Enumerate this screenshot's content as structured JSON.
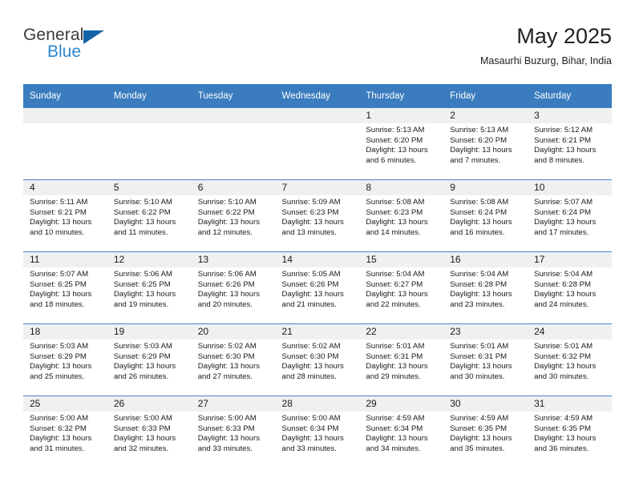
{
  "brand": {
    "name_top": "General",
    "name_bottom": "Blue",
    "triangle_color": "#1463a8",
    "blue_color": "#2a87d0"
  },
  "header": {
    "title": "May 2025",
    "subtitle": "Masaurhi Buzurg, Bihar, India"
  },
  "theme": {
    "header_bg": "#3a7cbe",
    "row_divider": "#4a86c0",
    "numband_bg": "#f0f0f0",
    "cell_bg": "#ffffff"
  },
  "weekday_headers": [
    "Sunday",
    "Monday",
    "Tuesday",
    "Wednesday",
    "Thursday",
    "Friday",
    "Saturday"
  ],
  "weeks": [
    [
      {
        "day": "",
        "sunrise": "",
        "sunset": "",
        "daylight": ""
      },
      {
        "day": "",
        "sunrise": "",
        "sunset": "",
        "daylight": ""
      },
      {
        "day": "",
        "sunrise": "",
        "sunset": "",
        "daylight": ""
      },
      {
        "day": "",
        "sunrise": "",
        "sunset": "",
        "daylight": ""
      },
      {
        "day": "1",
        "sunrise": "Sunrise: 5:13 AM",
        "sunset": "Sunset: 6:20 PM",
        "daylight": "Daylight: 13 hours and 6 minutes."
      },
      {
        "day": "2",
        "sunrise": "Sunrise: 5:13 AM",
        "sunset": "Sunset: 6:20 PM",
        "daylight": "Daylight: 13 hours and 7 minutes."
      },
      {
        "day": "3",
        "sunrise": "Sunrise: 5:12 AM",
        "sunset": "Sunset: 6:21 PM",
        "daylight": "Daylight: 13 hours and 8 minutes."
      }
    ],
    [
      {
        "day": "4",
        "sunrise": "Sunrise: 5:11 AM",
        "sunset": "Sunset: 6:21 PM",
        "daylight": "Daylight: 13 hours and 10 minutes."
      },
      {
        "day": "5",
        "sunrise": "Sunrise: 5:10 AM",
        "sunset": "Sunset: 6:22 PM",
        "daylight": "Daylight: 13 hours and 11 minutes."
      },
      {
        "day": "6",
        "sunrise": "Sunrise: 5:10 AM",
        "sunset": "Sunset: 6:22 PM",
        "daylight": "Daylight: 13 hours and 12 minutes."
      },
      {
        "day": "7",
        "sunrise": "Sunrise: 5:09 AM",
        "sunset": "Sunset: 6:23 PM",
        "daylight": "Daylight: 13 hours and 13 minutes."
      },
      {
        "day": "8",
        "sunrise": "Sunrise: 5:08 AM",
        "sunset": "Sunset: 6:23 PM",
        "daylight": "Daylight: 13 hours and 14 minutes."
      },
      {
        "day": "9",
        "sunrise": "Sunrise: 5:08 AM",
        "sunset": "Sunset: 6:24 PM",
        "daylight": "Daylight: 13 hours and 16 minutes."
      },
      {
        "day": "10",
        "sunrise": "Sunrise: 5:07 AM",
        "sunset": "Sunset: 6:24 PM",
        "daylight": "Daylight: 13 hours and 17 minutes."
      }
    ],
    [
      {
        "day": "11",
        "sunrise": "Sunrise: 5:07 AM",
        "sunset": "Sunset: 6:25 PM",
        "daylight": "Daylight: 13 hours and 18 minutes."
      },
      {
        "day": "12",
        "sunrise": "Sunrise: 5:06 AM",
        "sunset": "Sunset: 6:25 PM",
        "daylight": "Daylight: 13 hours and 19 minutes."
      },
      {
        "day": "13",
        "sunrise": "Sunrise: 5:06 AM",
        "sunset": "Sunset: 6:26 PM",
        "daylight": "Daylight: 13 hours and 20 minutes."
      },
      {
        "day": "14",
        "sunrise": "Sunrise: 5:05 AM",
        "sunset": "Sunset: 6:26 PM",
        "daylight": "Daylight: 13 hours and 21 minutes."
      },
      {
        "day": "15",
        "sunrise": "Sunrise: 5:04 AM",
        "sunset": "Sunset: 6:27 PM",
        "daylight": "Daylight: 13 hours and 22 minutes."
      },
      {
        "day": "16",
        "sunrise": "Sunrise: 5:04 AM",
        "sunset": "Sunset: 6:28 PM",
        "daylight": "Daylight: 13 hours and 23 minutes."
      },
      {
        "day": "17",
        "sunrise": "Sunrise: 5:04 AM",
        "sunset": "Sunset: 6:28 PM",
        "daylight": "Daylight: 13 hours and 24 minutes."
      }
    ],
    [
      {
        "day": "18",
        "sunrise": "Sunrise: 5:03 AM",
        "sunset": "Sunset: 6:29 PM",
        "daylight": "Daylight: 13 hours and 25 minutes."
      },
      {
        "day": "19",
        "sunrise": "Sunrise: 5:03 AM",
        "sunset": "Sunset: 6:29 PM",
        "daylight": "Daylight: 13 hours and 26 minutes."
      },
      {
        "day": "20",
        "sunrise": "Sunrise: 5:02 AM",
        "sunset": "Sunset: 6:30 PM",
        "daylight": "Daylight: 13 hours and 27 minutes."
      },
      {
        "day": "21",
        "sunrise": "Sunrise: 5:02 AM",
        "sunset": "Sunset: 6:30 PM",
        "daylight": "Daylight: 13 hours and 28 minutes."
      },
      {
        "day": "22",
        "sunrise": "Sunrise: 5:01 AM",
        "sunset": "Sunset: 6:31 PM",
        "daylight": "Daylight: 13 hours and 29 minutes."
      },
      {
        "day": "23",
        "sunrise": "Sunrise: 5:01 AM",
        "sunset": "Sunset: 6:31 PM",
        "daylight": "Daylight: 13 hours and 30 minutes."
      },
      {
        "day": "24",
        "sunrise": "Sunrise: 5:01 AM",
        "sunset": "Sunset: 6:32 PM",
        "daylight": "Daylight: 13 hours and 30 minutes."
      }
    ],
    [
      {
        "day": "25",
        "sunrise": "Sunrise: 5:00 AM",
        "sunset": "Sunset: 6:32 PM",
        "daylight": "Daylight: 13 hours and 31 minutes."
      },
      {
        "day": "26",
        "sunrise": "Sunrise: 5:00 AM",
        "sunset": "Sunset: 6:33 PM",
        "daylight": "Daylight: 13 hours and 32 minutes."
      },
      {
        "day": "27",
        "sunrise": "Sunrise: 5:00 AM",
        "sunset": "Sunset: 6:33 PM",
        "daylight": "Daylight: 13 hours and 33 minutes."
      },
      {
        "day": "28",
        "sunrise": "Sunrise: 5:00 AM",
        "sunset": "Sunset: 6:34 PM",
        "daylight": "Daylight: 13 hours and 33 minutes."
      },
      {
        "day": "29",
        "sunrise": "Sunrise: 4:59 AM",
        "sunset": "Sunset: 6:34 PM",
        "daylight": "Daylight: 13 hours and 34 minutes."
      },
      {
        "day": "30",
        "sunrise": "Sunrise: 4:59 AM",
        "sunset": "Sunset: 6:35 PM",
        "daylight": "Daylight: 13 hours and 35 minutes."
      },
      {
        "day": "31",
        "sunrise": "Sunrise: 4:59 AM",
        "sunset": "Sunset: 6:35 PM",
        "daylight": "Daylight: 13 hours and 36 minutes."
      }
    ]
  ]
}
